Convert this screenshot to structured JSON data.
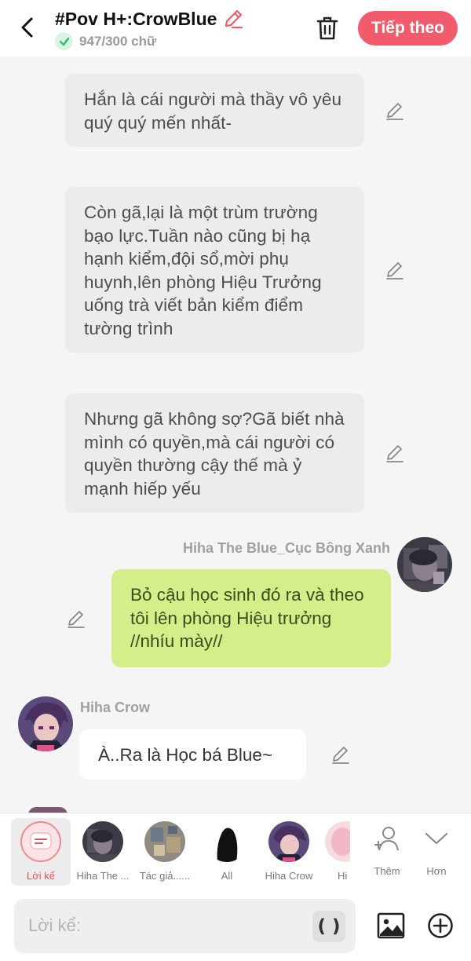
{
  "header": {
    "title": "#Pov H+:CrowBlue",
    "word_count": "947/300 chữ",
    "next_label": "Tiếp theo",
    "accent_color": "#f25b6c"
  },
  "messages": {
    "narration_1": "Hắn là cái người mà thầy vô yêu quý quý mến nhất-",
    "narration_2": "Còn gã,lại là một trùm trường bạo lực.Tuần nào cũng bị hạ hạnh kiểm,đội sổ,mời phụ huynh,lên phòng Hiệu Trưởng uống trà viết bản kiểm điểm tường trình",
    "narration_3": "Nhưng gã không sợ?Gã biết nhà mình có quyền,mà cái người có quyền thường cậy thế mà ỷ mạnh hiếp yếu",
    "blue_name": "Hiha The Blue_Cục Bông Xanh",
    "blue_text": "Bỏ cậu học sinh đó ra và theo tôi lên phòng Hiệu trưởng //nhíu mày//",
    "crow_name": "Hiha Crow",
    "crow_text": "À..Ra là Học bá Blue~"
  },
  "character_bar": {
    "items": [
      {
        "label": "Lời kể",
        "icon": "narration-icon",
        "selected": true
      },
      {
        "label": "Hiha The ...",
        "icon": "avatar-blue"
      },
      {
        "label": "Tác giả......",
        "icon": "avatar-author"
      },
      {
        "label": "All",
        "icon": "avatar-silhouette"
      },
      {
        "label": "Hiha Crow",
        "icon": "avatar-crow"
      },
      {
        "label": "Hi",
        "icon": "avatar-pink"
      }
    ],
    "more_label": "Thêm",
    "collapse_label": "Hơn"
  },
  "input": {
    "placeholder": "Lời kể:",
    "paren_label": "( )"
  },
  "colors": {
    "narration_bg": "#ececec",
    "user_bubble": "#d4ef8a",
    "background": "#f5f5f5"
  }
}
